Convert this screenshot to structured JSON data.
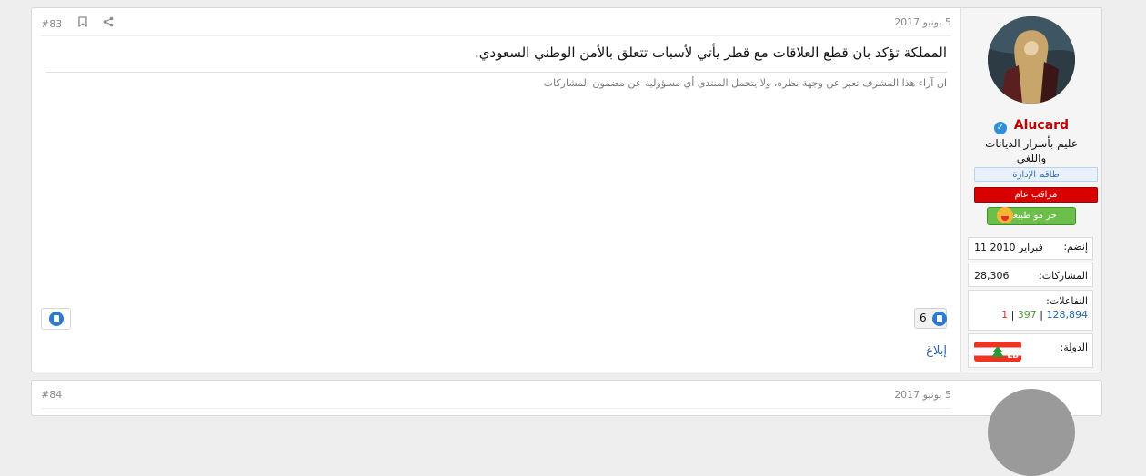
{
  "post": {
    "date": "5 يونيو 2017",
    "number": "#83",
    "message": "المملكة تؤكد بان قطع العلاقات مع قطر يأتي لأسباب تتعلق بالأمن الوطني السعودي.",
    "disclaimer": "ان آراء هذا المشرف تعبر عن وجهة نظره، ولا يتحمل المنتدى أي مسؤولية عن مضمون المشاركات",
    "reaction_count": "6",
    "report_label": "إبلاغ",
    "like_icon": "like-icon",
    "share_icon": "share-icon",
    "bookmark_icon": "bookmark-icon"
  },
  "user": {
    "name": "Alucard",
    "title": "عليم بأسرار الديانات واللغى",
    "banner_staff": "طاقم الإدارة",
    "banner_mod": "مراقب عام",
    "mood": "حر مو طبيعي",
    "join_label": "إنضم:",
    "join_value": "11 فبراير 2010",
    "posts_label": "المشاركات:",
    "posts_value": "28,306",
    "reactions_label": "التفاعلات:",
    "reactions_positive": "128,894",
    "reactions_neutral": "397",
    "reactions_negative": "1",
    "country_label": "الدولة:",
    "country_flag_text": "LB"
  },
  "next_post": {
    "date": "5 يونيو 2017",
    "number": "#84"
  },
  "colors": {
    "username": "#c00000",
    "mod_banner": "#d90000",
    "link": "#2a64a8"
  }
}
